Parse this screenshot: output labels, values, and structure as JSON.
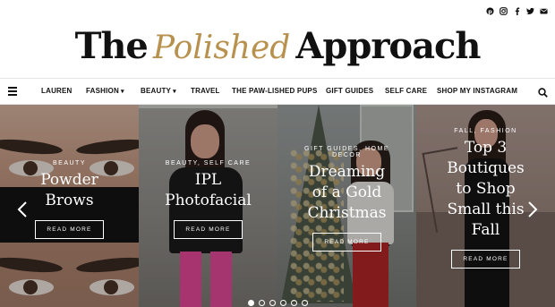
{
  "site": {
    "logo_part1": "The",
    "logo_part2": "Polished",
    "logo_part3": "Approach"
  },
  "social_icons": [
    "pinterest-icon",
    "instagram-icon",
    "facebook-icon",
    "twitter-icon",
    "email-icon"
  ],
  "nav": {
    "items": [
      {
        "label": "LAUREN",
        "has_dropdown": false
      },
      {
        "label": "FASHION",
        "has_dropdown": true
      },
      {
        "label": "BEAUTY",
        "has_dropdown": true
      },
      {
        "label": "TRAVEL",
        "has_dropdown": false
      },
      {
        "label": "THE PAW-LISHED PUPS",
        "has_dropdown": false
      },
      {
        "label": "GIFT GUIDES",
        "has_dropdown": false
      },
      {
        "label": "SELF CARE",
        "has_dropdown": false
      },
      {
        "label": "SHOP MY INSTAGRAM",
        "has_dropdown": false
      }
    ],
    "dropdown_glyph": "❯"
  },
  "slides": [
    {
      "category": "BEAUTY",
      "title_line1": "Powder",
      "title_line2": "Brows",
      "button": "READ MORE"
    },
    {
      "category": "BEAUTY, SELF CARE",
      "title_line1": "IPL",
      "title_line2": "Photofacial",
      "button": "READ MORE"
    },
    {
      "category_line1": "GIFT GUIDES, HOME",
      "category_line2": "DECOR",
      "title_line1": "Dreaming",
      "title_line2": "of a Gold",
      "title_line3": "Christmas",
      "button": "READ MORE"
    },
    {
      "category": "FALL, FASHION",
      "title_line1": "Top 3",
      "title_line2": "Boutiques",
      "title_line3": "to Shop",
      "title_line4": "Small this",
      "title_line5": "Fall",
      "button": "READ MORE"
    }
  ],
  "pagination": {
    "count": 6,
    "active": 0
  }
}
